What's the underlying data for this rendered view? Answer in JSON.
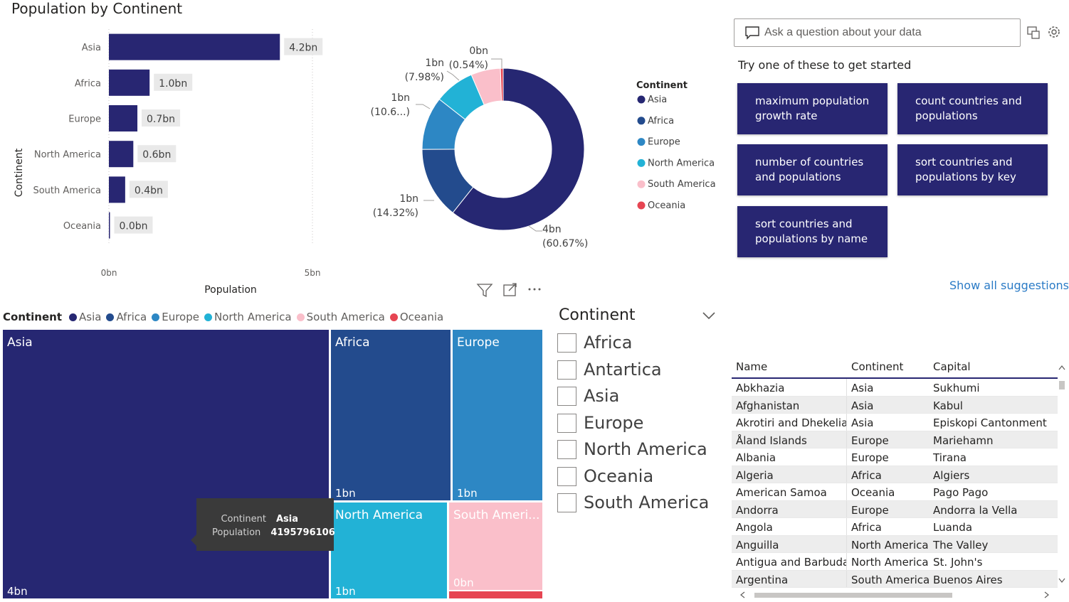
{
  "bar_chart": {
    "title": "Population by Continent",
    "xlabel": "Population",
    "ylabel": "Continent",
    "x_ticks": [
      "0bn",
      "5bn"
    ]
  },
  "donut_legend": {
    "title": "Continent",
    "items": [
      "Asia",
      "Africa",
      "Europe",
      "North America",
      "South America",
      "Oceania"
    ]
  },
  "qa": {
    "placeholder": "Ask a question about your data",
    "hint": "Try one of these to get started",
    "suggestions": [
      "maximum population growth rate",
      "count countries and populations",
      "number of countries and populations",
      "sort countries and populations by key",
      "sort countries and populations by name"
    ],
    "show_all": "Show all suggestions"
  },
  "treemap": {
    "legend_title": "Continent",
    "legend_items": [
      "Asia",
      "Africa",
      "Europe",
      "North America",
      "South America",
      "Oceania"
    ],
    "tiles": [
      {
        "name": "Asia",
        "value": "4bn"
      },
      {
        "name": "Africa",
        "value": "1bn"
      },
      {
        "name": "Europe",
        "value": "1bn"
      },
      {
        "name": "North America",
        "value": "1bn"
      },
      {
        "name": "South Ameri...",
        "value": "0bn"
      }
    ],
    "tooltip": {
      "k1": "Continent",
      "v1": "Asia",
      "k2": "Population",
      "v2": "4195796106"
    }
  },
  "slicer": {
    "title": "Continent",
    "items": [
      "Africa",
      "Antartica",
      "Asia",
      "Europe",
      "North America",
      "Oceania",
      "South America"
    ]
  },
  "table": {
    "headers": [
      "Name",
      "Continent",
      "Capital"
    ],
    "rows": [
      [
        "Abkhazia",
        "Asia",
        "Sukhumi"
      ],
      [
        "Afghanistan",
        "Asia",
        "Kabul"
      ],
      [
        "Akrotiri and Dhekelia",
        "Asia",
        "Episkopi Cantonment"
      ],
      [
        "Åland Islands",
        "Europe",
        "Mariehamn"
      ],
      [
        "Albania",
        "Europe",
        "Tirana"
      ],
      [
        "Algeria",
        "Africa",
        "Algiers"
      ],
      [
        "American Samoa",
        "Oceania",
        "Pago Pago"
      ],
      [
        "Andorra",
        "Europe",
        "Andorra la Vella"
      ],
      [
        "Angola",
        "Africa",
        "Luanda"
      ],
      [
        "Anguilla",
        "North America",
        "The Valley"
      ],
      [
        "Antigua and Barbuda",
        "North America",
        "St. John's"
      ],
      [
        "Argentina",
        "South America",
        "Buenos Aires"
      ]
    ]
  },
  "colors": {
    "Asia": "#262772",
    "Africa": "#234b8d",
    "Europe": "#2d87c4",
    "North America": "#22b2d6",
    "South America": "#fabfca",
    "Oceania": "#e64552",
    "button": "#282672",
    "link": "#2b7bc6"
  },
  "chart_data": [
    {
      "type": "bar",
      "title": "Population by Continent",
      "xlabel": "Population",
      "ylabel": "Continent",
      "categories": [
        "Asia",
        "Africa",
        "Europe",
        "North America",
        "South America",
        "Oceania"
      ],
      "values": [
        4.2,
        1.0,
        0.7,
        0.6,
        0.4,
        0.0
      ],
      "data_labels": [
        "4.2bn",
        "1.0bn",
        "0.7bn",
        "0.6bn",
        "0.4bn",
        "0.0bn"
      ],
      "xlim": [
        0,
        5
      ],
      "grid": true
    },
    {
      "type": "pie",
      "donut": true,
      "legend_title": "Continent",
      "legend_position": "right",
      "categories": [
        "Asia",
        "Africa",
        "Europe",
        "North America",
        "South America",
        "Oceania"
      ],
      "percentages": [
        60.67,
        14.32,
        10.6,
        7.98,
        5.89,
        0.54
      ],
      "labels": [
        {
          "value": "4bn",
          "pct": "(60.67%)"
        },
        {
          "value": "1bn",
          "pct": "(14.32%)"
        },
        {
          "value": "1bn",
          "pct": "(10.6...)"
        },
        {
          "value": "1bn",
          "pct": "(7.98%)"
        },
        null,
        {
          "value": "0bn",
          "pct": "(0.54%)"
        }
      ]
    }
  ]
}
